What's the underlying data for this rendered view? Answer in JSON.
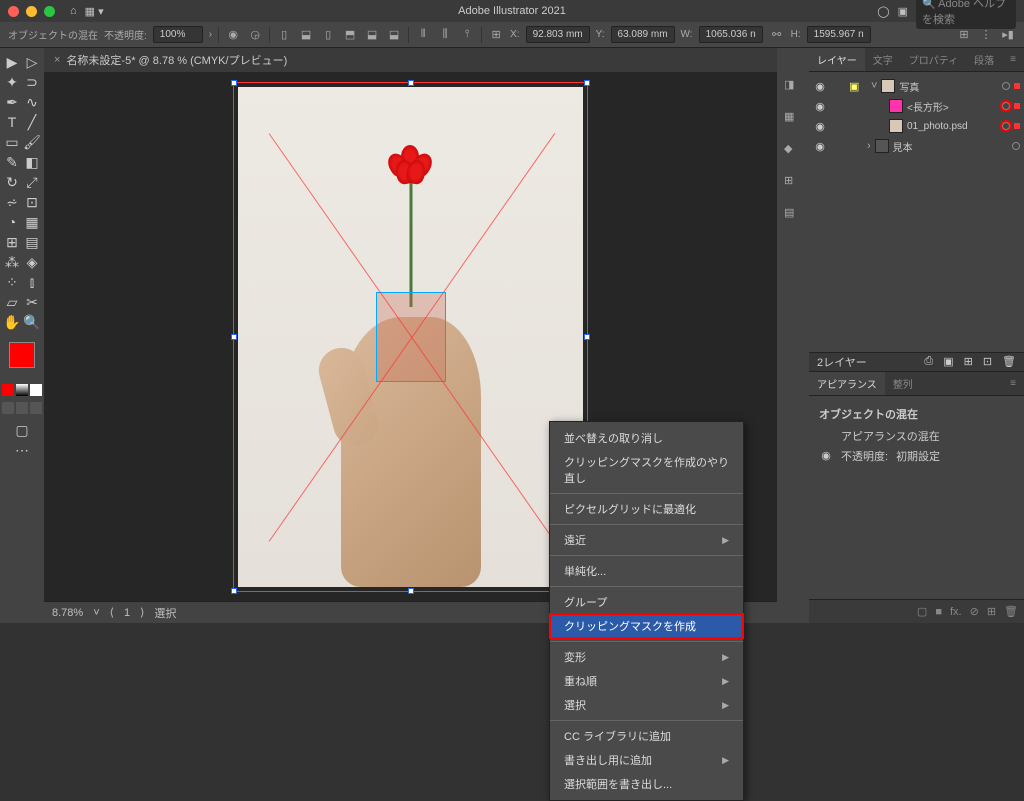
{
  "app_title": "Adobe Illustrator 2021",
  "search_placeholder": "Adobe ヘルプを検索",
  "controlbar": {
    "selection_label": "オブジェクトの混在",
    "opacity_label": "不透明度:",
    "opacity_value": "100%",
    "x_label": "X:",
    "x_value": "92.803 mm",
    "y_label": "Y:",
    "y_value": "63.089 mm",
    "w_label": "W:",
    "w_value": "1065.036 n",
    "h_label": "H:",
    "h_value": "1595.967 n"
  },
  "doc_tab": "名称未設定-5* @ 8.78 % (CMYK/プレビュー)",
  "status": {
    "zoom": "8.78%",
    "artboard": "1",
    "tool": "選択"
  },
  "context_menu": {
    "undo": "並べ替えの取り消し",
    "redo": "クリッピングマスクを作成のやり直し",
    "pixel": "ピクセルグリッドに最適化",
    "perspective": "遠近",
    "simplify": "単純化...",
    "group": "グループ",
    "clip": "クリッピングマスクを作成",
    "transform": "変形",
    "arrange": "重ね順",
    "select": "選択",
    "cclib": "CC ライブラリに追加",
    "export_use": "書き出し用に追加",
    "export_range": "選択範囲を書き出し..."
  },
  "panels": {
    "tab_layers": "レイヤー",
    "tab_text": "文字",
    "tab_properties": "プロパティ",
    "tab_lines": "段落",
    "layer1": "写真",
    "sublayer1": "<長方形>",
    "sublayer2": "01_photo.psd",
    "layer2": "見本",
    "layers_count": "2レイヤー",
    "tab_appearance": "アピアランス",
    "tab_align": "整列",
    "app_title": "オブジェクトの混在",
    "app_mixed": "アピアランスの混在",
    "app_opacity_label": "不透明度:",
    "app_opacity_val": "初期設定"
  }
}
